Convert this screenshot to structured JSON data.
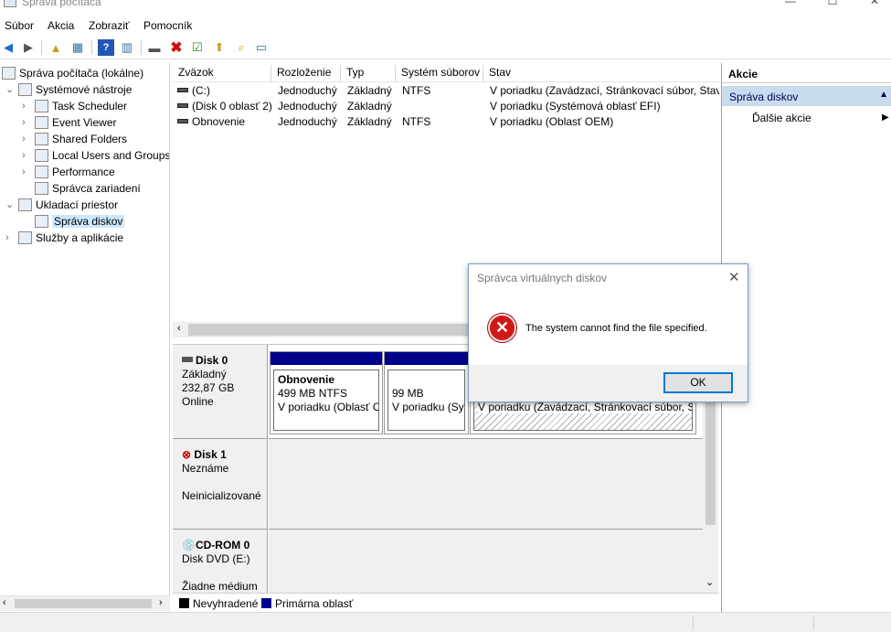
{
  "window": {
    "title": "Správa počítača"
  },
  "menu": [
    "Súbor",
    "Akcia",
    "Zobraziť",
    "Pomocník"
  ],
  "tree": {
    "root": "Správa počítača (lokálne)",
    "system_tools": "Systémové nástroje",
    "task_scheduler": "Task Scheduler",
    "event_viewer": "Event Viewer",
    "shared_folders": "Shared Folders",
    "local_users": "Local Users and Groups",
    "performance": "Performance",
    "device_manager": "Správca zariadení",
    "storage": "Ukladací priestor",
    "disk_mgmt": "Správa diskov",
    "services": "Služby a aplikácie"
  },
  "volumes": {
    "headers": [
      "Zväzok",
      "Rozloženie",
      "Typ",
      "Systém súborov",
      "Stav"
    ],
    "rows": [
      {
        "name": "(C:)",
        "layout": "Jednoduchý",
        "type": "Základný",
        "fs": "NTFS",
        "status": "V poriadku (Zavádzací, Stránkovací súbor, Stav"
      },
      {
        "name": "(Disk 0 oblasť 2)",
        "layout": "Jednoduchý",
        "type": "Základný",
        "fs": "",
        "status": "V poriadku (Systémová oblasť EFI)"
      },
      {
        "name": "Obnovenie",
        "layout": "Jednoduchý",
        "type": "Základný",
        "fs": "NTFS",
        "status": "V poriadku (Oblasť OEM)"
      }
    ]
  },
  "disks": {
    "disk0": {
      "name": "Disk 0",
      "type": "Základný",
      "size": "232,87 GB",
      "state": "Online"
    },
    "disk0_parts": [
      {
        "title": "Obnovenie",
        "line1": "499 MB NTFS",
        "line2": "V poriadku (Oblasť O"
      },
      {
        "title": "",
        "line1": "99 MB",
        "line2": "V poriadku (Sy"
      },
      {
        "title": "",
        "line1": "",
        "line2": "V poriadku (Zavádzací, Stránkovací súbor, Sta"
      }
    ],
    "disk1": {
      "name": "Disk 1",
      "type": "Neznáme",
      "state": "Neinicializované"
    },
    "cdrom": {
      "name": "CD-ROM 0",
      "type": "Disk DVD (E:)",
      "state": "Žiadne médium"
    }
  },
  "legend": {
    "unallocated": "Nevyhradené",
    "primary": "Primárna oblasť",
    "unallocated_color": "#000000",
    "primary_color": "#00008b"
  },
  "actions": {
    "header": "Akcie",
    "section": "Správa diskov",
    "more": "Ďalšie akcie"
  },
  "dialog": {
    "title": "Správca virtuálnych diskov",
    "message": "The system cannot find the file specified.",
    "ok": "OK",
    "icon": "error-icon"
  }
}
